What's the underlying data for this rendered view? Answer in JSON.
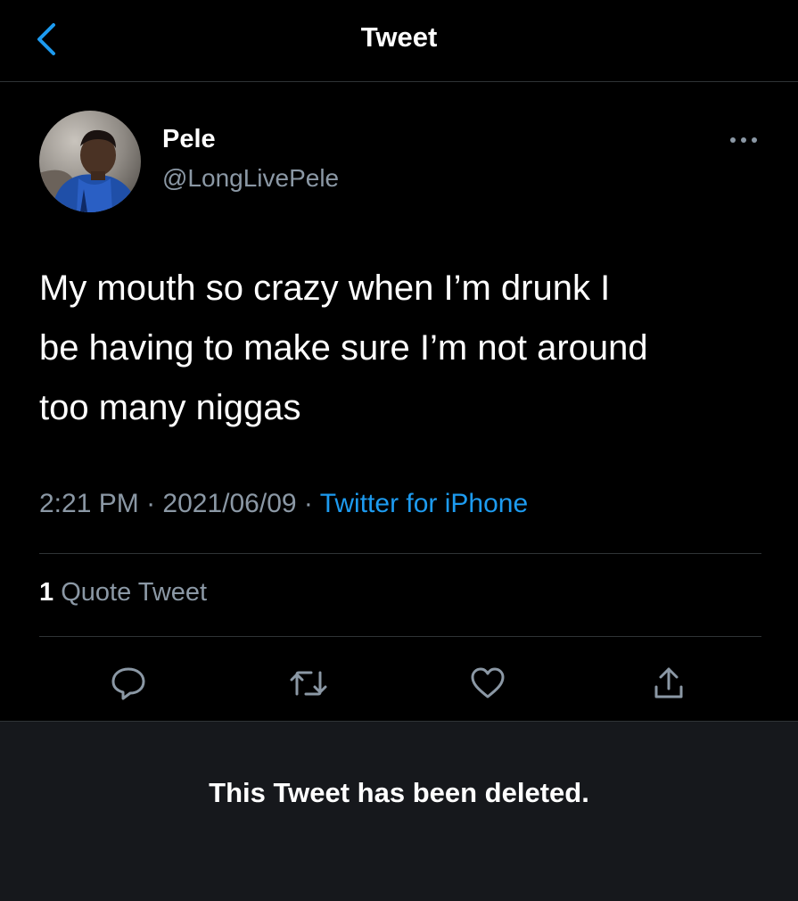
{
  "colors": {
    "background": "#000000",
    "accent": "#1d9bf0",
    "secondary_text": "#8b98a5",
    "divider": "#2f3336",
    "deleted_panel": "#16181c"
  },
  "header": {
    "back_icon": "chevron-left-icon",
    "title": "Tweet"
  },
  "tweet": {
    "author": {
      "display_name": "Pele",
      "handle": "@LongLivePele",
      "avatar_icon": "avatar-photo"
    },
    "more_icon": "more-dots-icon",
    "text": "My mouth so crazy when I’m drunk I\nbe having to make sure I’m not around\ntoo many niggas",
    "time": "2:21 PM",
    "date": "2021/06/09",
    "separator": "·",
    "source": "Twitter for iPhone",
    "stats": {
      "quote_count": "1",
      "quote_label": "Quote Tweet"
    },
    "actions": [
      {
        "name": "reply",
        "icon": "reply-icon"
      },
      {
        "name": "retweet",
        "icon": "retweet-icon"
      },
      {
        "name": "like",
        "icon": "heart-icon"
      },
      {
        "name": "share",
        "icon": "share-icon"
      }
    ]
  },
  "quoted": {
    "deleted_message": "This Tweet has been deleted."
  }
}
